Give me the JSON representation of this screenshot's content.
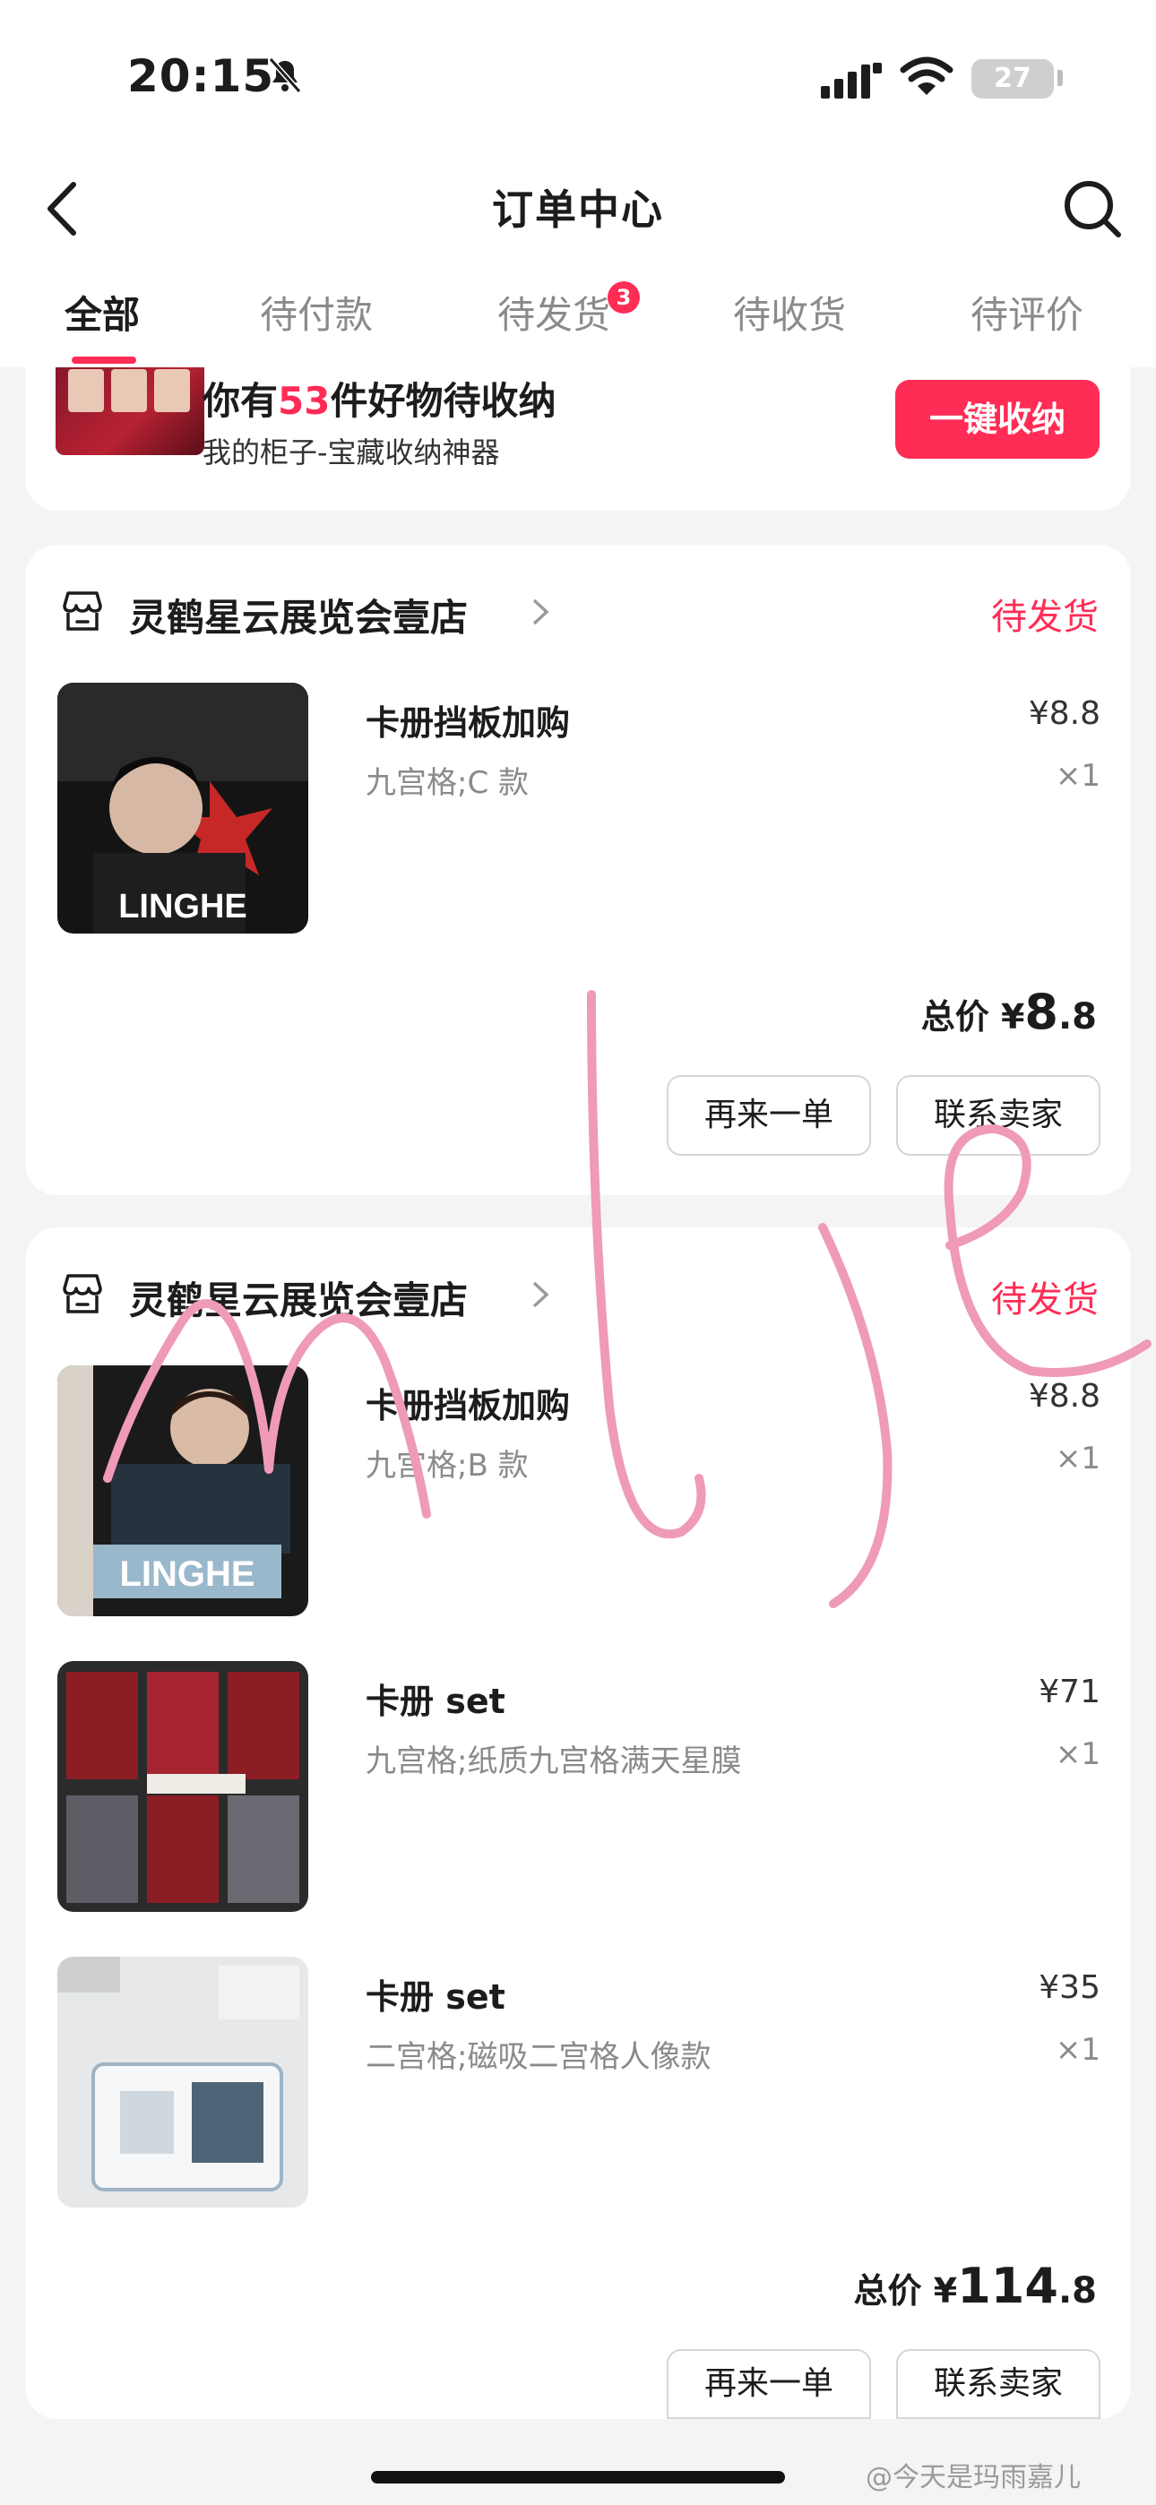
{
  "status_bar": {
    "time": "20:15",
    "battery": "27"
  },
  "nav": {
    "title": "订单中心"
  },
  "tabs": [
    {
      "label": "全部",
      "active": true
    },
    {
      "label": "待付款"
    },
    {
      "label": "待发货",
      "badge": "3"
    },
    {
      "label": "待收货"
    },
    {
      "label": "待评价"
    }
  ],
  "promo": {
    "title_prefix": "你有",
    "count": "53",
    "title_suffix": "件好物待收纳",
    "subtitle": "我的柜子-宝藏收纳神器",
    "button": "一键收纳"
  },
  "orders": [
    {
      "shop": "灵鹤星云展览会壹店",
      "status": "待发货",
      "items": [
        {
          "name": "卡册挡板加购",
          "spec": "九宫格;C 款",
          "price": "¥8.8",
          "qty": "×1",
          "thumb_text": "LINGHE"
        }
      ],
      "total_label": "总价",
      "total_currency": "¥",
      "total_int": "8",
      "total_dec": ".8",
      "buttons": [
        "再来一单",
        "联系卖家"
      ]
    },
    {
      "shop": "灵鹤星云展览会壹店",
      "status": "待发货",
      "items": [
        {
          "name": "卡册挡板加购",
          "spec": "九宫格;B 款",
          "price": "¥8.8",
          "qty": "×1",
          "thumb_text": "LINGHE"
        },
        {
          "name": "卡册 set",
          "spec": "九宫格;纸质九宫格满天星膜",
          "price": "¥71",
          "qty": "×1"
        },
        {
          "name": "卡册 set",
          "spec": "二宫格;磁吸二宫格人像款",
          "price": "¥35",
          "qty": "×1"
        }
      ],
      "total_label": "总价",
      "total_currency": "¥",
      "total_int": "114",
      "total_dec": ".8",
      "buttons": [
        "再来一单",
        "联系卖家"
      ]
    }
  ],
  "watermark": "@今天是玛雨嘉儿",
  "colors": {
    "accent": "#ff2c55",
    "background": "#f4f4f4",
    "card": "#ffffff"
  }
}
